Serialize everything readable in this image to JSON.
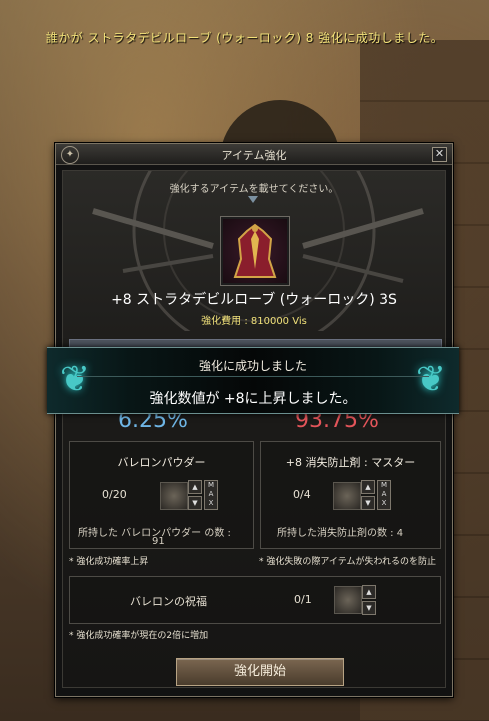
{
  "system_message": "誰かが ストラタデビルローブ (ウォーロック) 8 強化に成功しました。",
  "window": {
    "title": "アイテム強化",
    "instruction": "強化するアイテムを載せてください。",
    "item_name": "+8 ストラタデビルローブ (ウォーロック) 3S",
    "cost": "強化費用 : 810000 Vis",
    "success_rate": "6.25%",
    "fail_rate": "93.75%",
    "material_left": {
      "title": "バレロンパウダー",
      "count": "0/20",
      "owned_line1": "所持した バレロンパウダー の数 :",
      "owned_line2": "91",
      "note": "* 強化成功確率上昇"
    },
    "material_right": {
      "title": "+8 消失防止剤 : マスター",
      "count": "0/4",
      "owned": "所持した消失防止剤の数 : 4",
      "note": "* 強化失敗の際アイテムが失われるのを防止"
    },
    "blessing": {
      "title": "バレロンの祝福",
      "count": "0/1",
      "note": "* 強化成功確率が現在の2倍に増加"
    },
    "start_button": "強化開始",
    "close_icon": "close-icon"
  },
  "banner": {
    "line1": "強化に成功しました",
    "line2": "強化数値が +8に上昇しました。"
  },
  "colors": {
    "success": "#6fb6e6",
    "fail": "#e4555a",
    "cost": "#f0e07a",
    "system_message": "#f3e27a"
  }
}
